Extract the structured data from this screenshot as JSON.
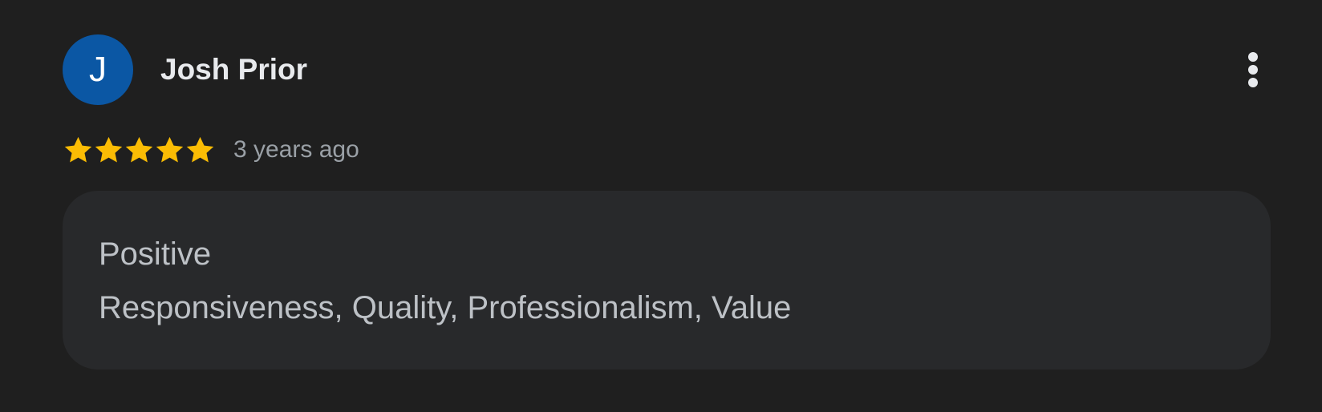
{
  "review": {
    "author": {
      "name": "Josh Prior",
      "initial": "J",
      "avatar_color": "#0b57a4"
    },
    "menu_icon": "more-vert-icon",
    "rating": 5,
    "rating_max": 5,
    "star_color": "#fbbc04",
    "time_ago": "3 years ago",
    "attributes": {
      "heading": "Positive",
      "values": "Responsiveness, Quality, Professionalism, Value"
    }
  }
}
